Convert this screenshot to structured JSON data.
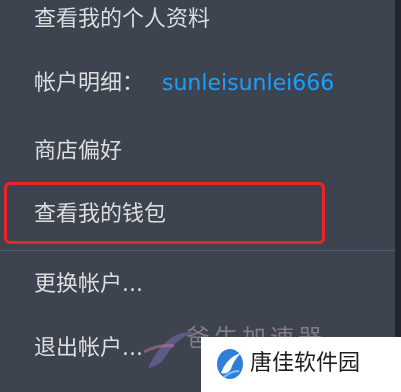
{
  "menu": {
    "profile_label": "查看我的个人资料",
    "account_label": "帐户明细：",
    "account_name": "sunleisunlei666",
    "prefs_label": "商店偏好",
    "wallet_label": "查看我的钱包",
    "change_label": "更换帐户...",
    "logout_label": "退出帐户..."
  },
  "watermark": {
    "faded_text": "爸牛加速器",
    "brand_text": "唐佳软件园"
  },
  "colors": {
    "menu_bg": "#3d4450",
    "text": "#dcdedf",
    "account_name": "#1a9fff",
    "highlight": "#e8262a"
  }
}
